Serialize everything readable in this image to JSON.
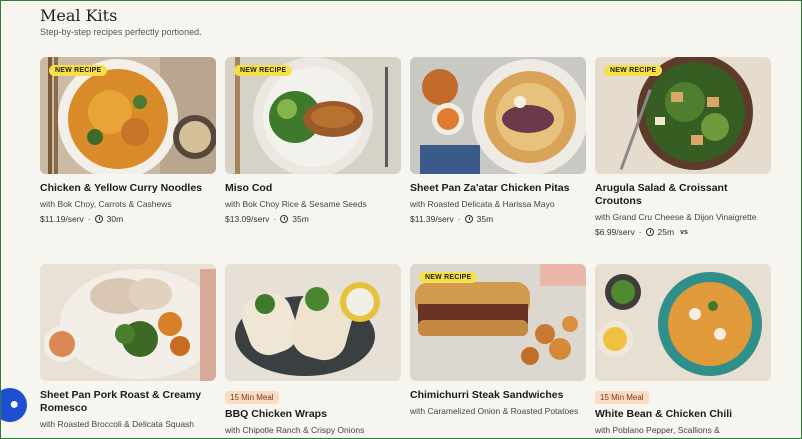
{
  "section": {
    "title": "Meal Kits",
    "subtitle": "Step-by-step recipes perfectly portioned."
  },
  "badges": {
    "new": "NEW RECIPE",
    "min": "15 Min Meal"
  },
  "cards": [
    {
      "name": "Chicken & Yellow Curry Noodles",
      "sub": "with Bok Choy, Carrots & Cashews",
      "price": "$11.19/serv",
      "time": "30m"
    },
    {
      "name": "Miso Cod",
      "sub": "with Bok Choy Rice & Sesame Seeds",
      "price": "$13.09/serv",
      "time": "35m"
    },
    {
      "name": "Sheet Pan Za'atar Chicken Pitas",
      "sub": "with Roasted Delicata & Harissa Mayo",
      "price": "$11.39/serv",
      "time": "35m"
    },
    {
      "name": "Arugula Salad & Croissant Croutons",
      "sub": "with Grand Cru Cheese & Dijon Vinaigrette",
      "price": "$6.99/serv",
      "time": "25m",
      "extra": "vs"
    },
    {
      "name": "Sheet Pan Pork Roast & Creamy Romesco",
      "sub": "with Roasted Broccoli & Delicata Squash"
    },
    {
      "name": "BBQ Chicken Wraps",
      "sub": "with Chipotle Ranch & Crispy Onions"
    },
    {
      "name": "Chimichurri Steak Sandwiches",
      "sub": "with Caramelized Onion & Roasted Potatoes"
    },
    {
      "name": "White Bean & Chicken Chili",
      "sub": "with Poblano Pepper, Scallions &"
    }
  ]
}
